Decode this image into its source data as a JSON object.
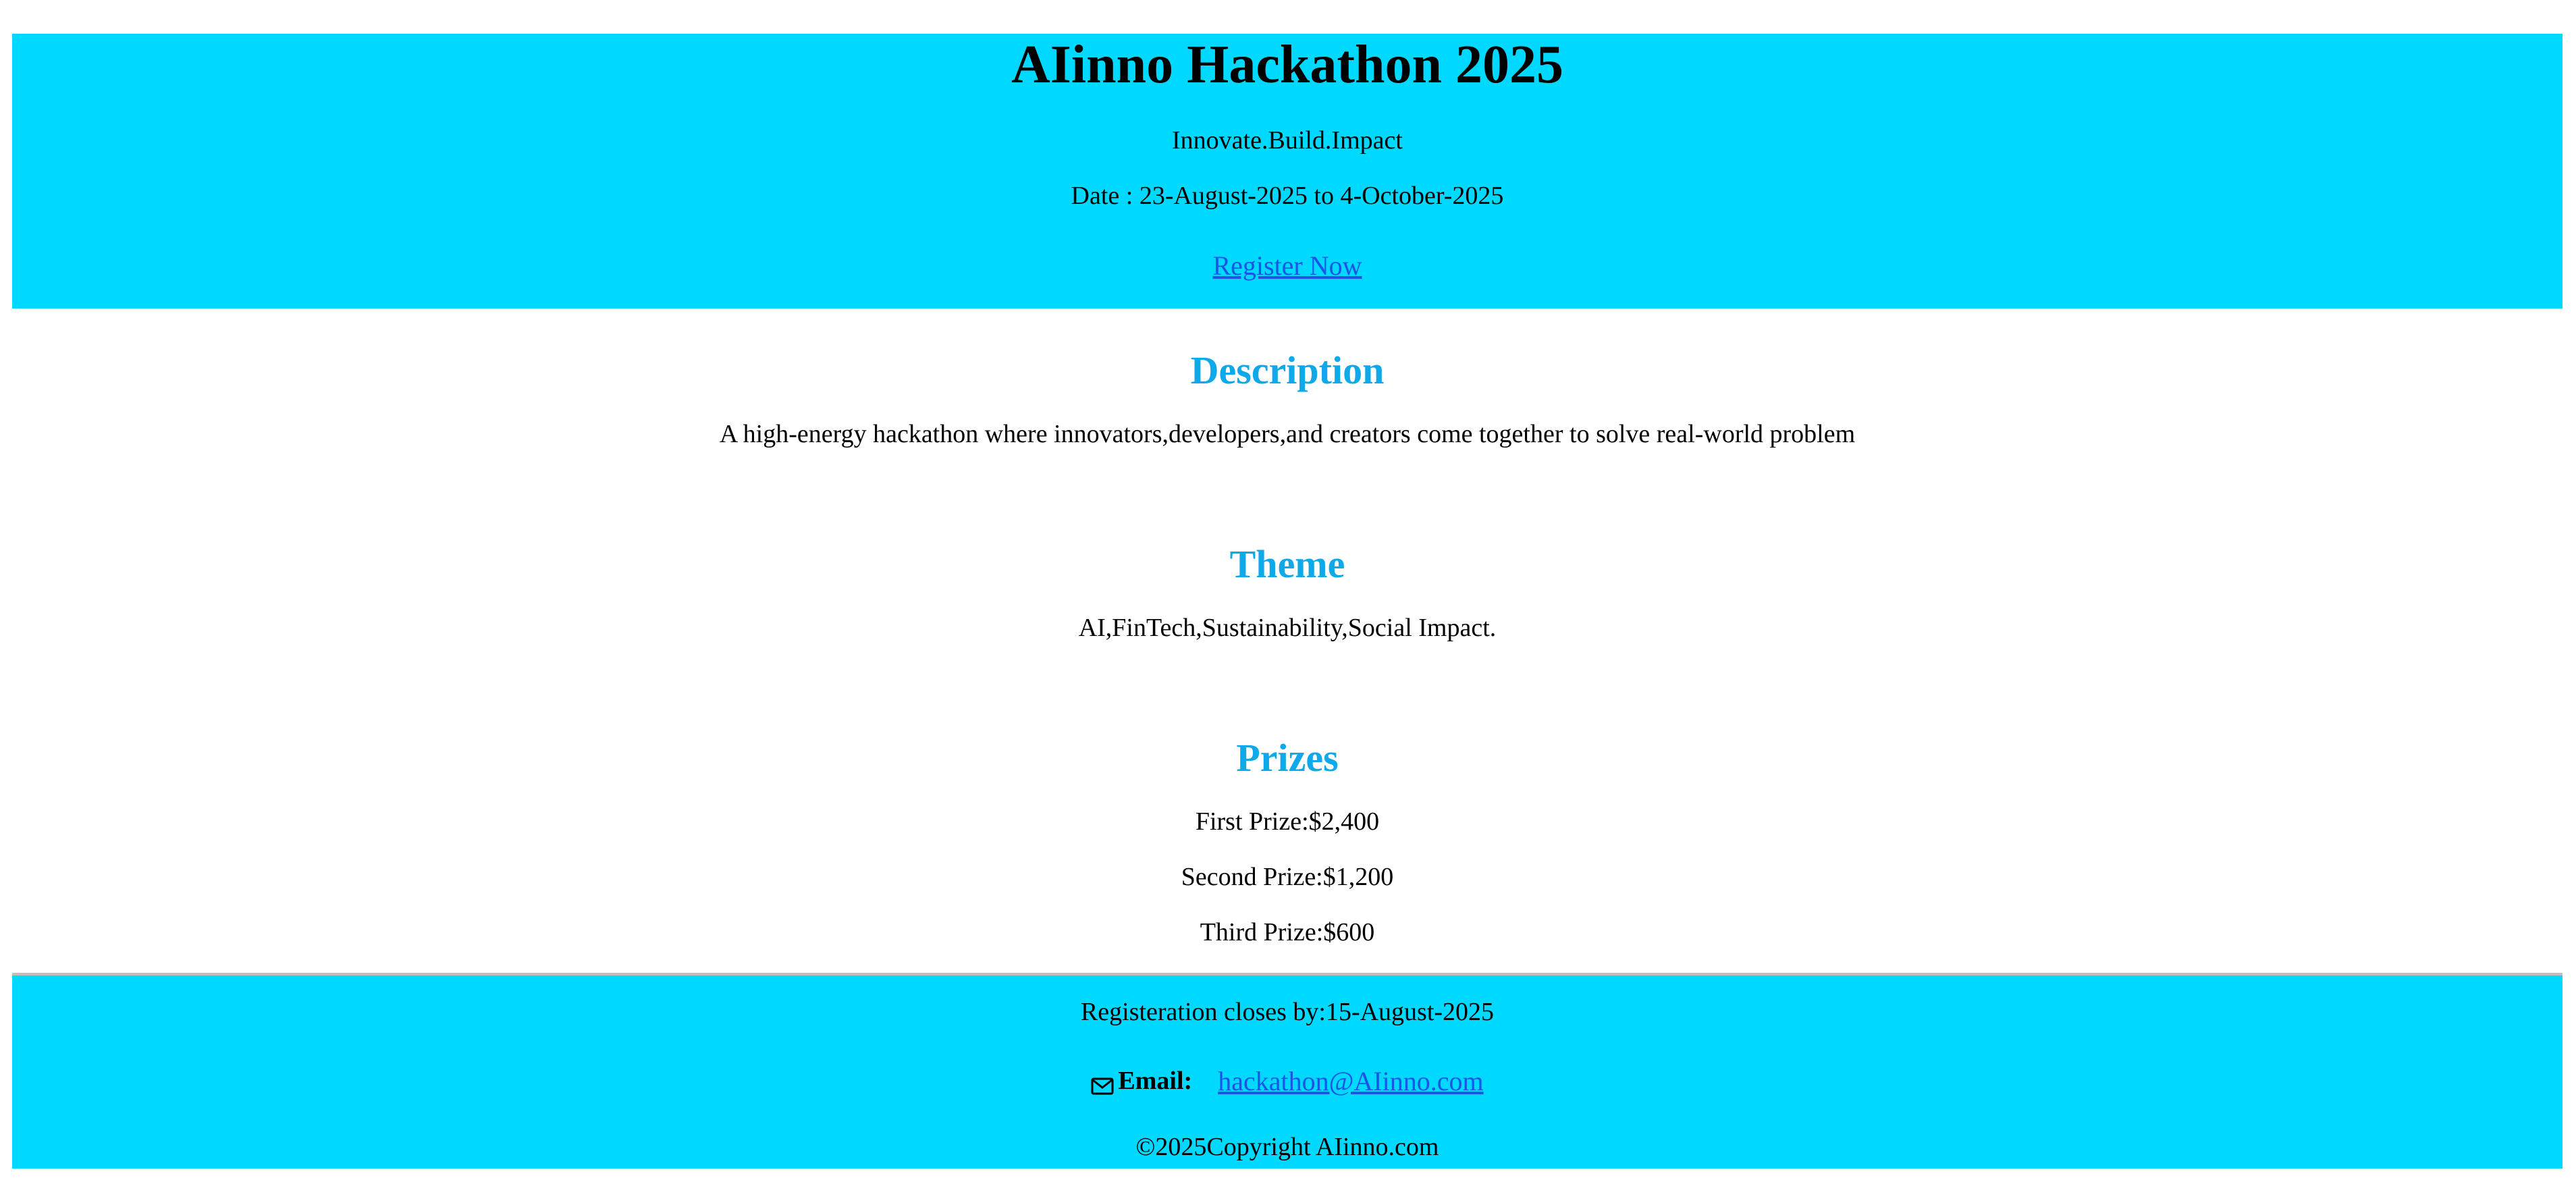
{
  "header": {
    "title": "AIinno Hackathon 2025",
    "tagline": "Innovate.Build.Impact",
    "date": "Date : 23-August-2025 to 4-October-2025",
    "register_label": "Register Now"
  },
  "description": {
    "heading": "Description",
    "text": "A high-energy hackathon where innovators,developers,and creators come together to solve real-world problem"
  },
  "theme": {
    "heading": "Theme",
    "text": "AI,FinTech,Sustainability,Social Impact."
  },
  "prizes": {
    "heading": "Prizes",
    "items": [
      "First Prize:$2,400",
      "Second Prize:$1,200",
      "Third Prize:$600"
    ]
  },
  "footer": {
    "closes": "Registeration closes by:15-August-2025",
    "email_label": "Email:",
    "email_value": "hackathon@AIinno.com",
    "email_icon": "mail-icon",
    "copyright": "©2025Copyright AIinno.com"
  },
  "colors": {
    "banner": "#00d9ff",
    "heading": "#0fa8e8",
    "link": "#1a55e8"
  }
}
